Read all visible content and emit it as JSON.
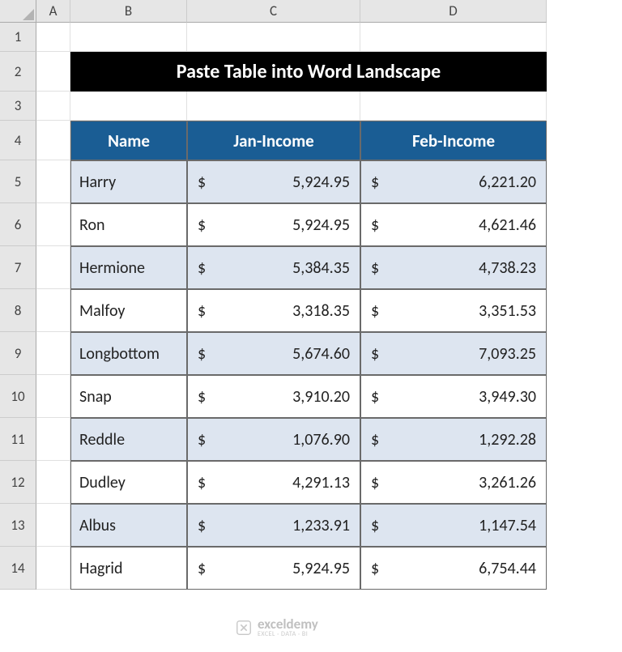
{
  "columns": [
    "A",
    "B",
    "C",
    "D"
  ],
  "row_numbers": [
    "1",
    "2",
    "3",
    "4",
    "5",
    "6",
    "7",
    "8",
    "9",
    "10",
    "11",
    "12",
    "13",
    "14"
  ],
  "title": "Paste Table into Word Landscape",
  "headers": [
    "Name",
    "Jan-Income",
    "Feb-Income"
  ],
  "currency": "$",
  "rows": [
    {
      "name": "Harry",
      "jan": "5,924.95",
      "feb": "6,221.20"
    },
    {
      "name": "Ron",
      "jan": "5,924.95",
      "feb": "4,621.46"
    },
    {
      "name": "Hermione",
      "jan": "5,384.35",
      "feb": "4,738.23"
    },
    {
      "name": "Malfoy",
      "jan": "3,318.35",
      "feb": "3,351.53"
    },
    {
      "name": "Longbottom",
      "jan": "5,674.60",
      "feb": "7,093.25"
    },
    {
      "name": "Snap",
      "jan": "3,910.20",
      "feb": "3,949.30"
    },
    {
      "name": "Reddle",
      "jan": "1,076.90",
      "feb": "1,292.28"
    },
    {
      "name": "Dudley",
      "jan": "4,291.13",
      "feb": "3,261.26"
    },
    {
      "name": "Albus",
      "jan": "1,233.91",
      "feb": "1,147.54"
    },
    {
      "name": "Hagrid",
      "jan": "5,924.95",
      "feb": "6,754.44"
    }
  ],
  "watermark": {
    "main": "exceldemy",
    "sub": "EXCEL · DATA · BI"
  },
  "chart_data": {
    "type": "table",
    "title": "Paste Table into Word Landscape",
    "columns": [
      "Name",
      "Jan-Income",
      "Feb-Income"
    ],
    "unit": "USD",
    "data": [
      [
        "Harry",
        5924.95,
        6221.2
      ],
      [
        "Ron",
        5924.95,
        4621.46
      ],
      [
        "Hermione",
        5384.35,
        4738.23
      ],
      [
        "Malfoy",
        3318.35,
        3351.53
      ],
      [
        "Longbottom",
        5674.6,
        7093.25
      ],
      [
        "Snap",
        3910.2,
        3949.3
      ],
      [
        "Reddle",
        1076.9,
        1292.28
      ],
      [
        "Dudley",
        4291.13,
        3261.26
      ],
      [
        "Albus",
        1233.91,
        1147.54
      ],
      [
        "Hagrid",
        5924.95,
        6754.44
      ]
    ]
  }
}
